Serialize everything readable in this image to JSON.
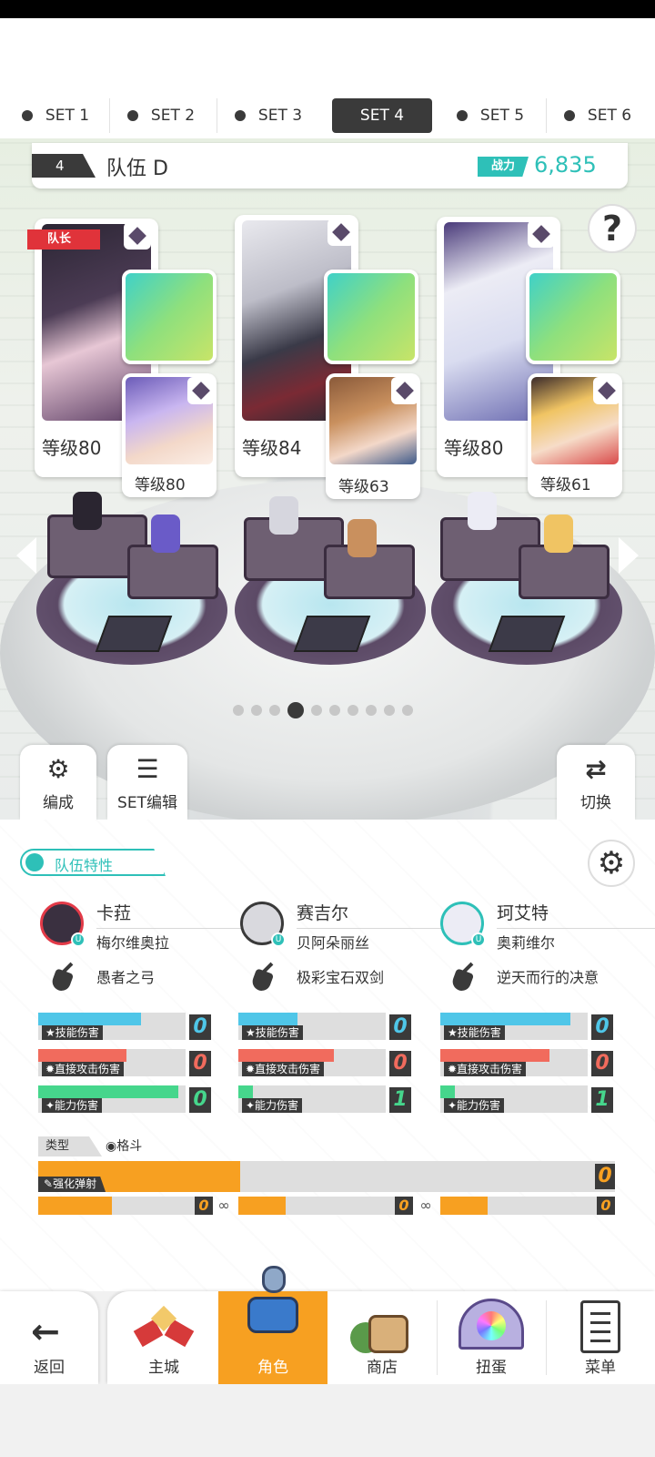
{
  "set_tabs": [
    "SET 1",
    "SET 2",
    "SET 3",
    "SET 4",
    "SET 5",
    "SET 6"
  ],
  "active_set_index": 3,
  "team": {
    "number": "4",
    "name": "队伍 D",
    "power_label": "战力",
    "power_value": "6,835"
  },
  "help_label": "?",
  "leader_tag": "队长",
  "characters": [
    {
      "level": "等级80",
      "sub_level": "等级80"
    },
    {
      "level": "等级84",
      "sub_level": "等级63"
    },
    {
      "level": "等级80",
      "sub_level": "等级61"
    }
  ],
  "page_dots": {
    "count": 10,
    "active_index": 3
  },
  "toolbar": {
    "formation_label": "编成",
    "set_edit_label": "SET编辑",
    "switch_label": "切换"
  },
  "team_traits": {
    "tab_label": "队伍特性"
  },
  "heroes": [
    {
      "name": "卡菈",
      "partner": "梅尔维奥拉",
      "weapon": "愚者之弓",
      "badge": "U",
      "stats": [
        {
          "label": "★技能伤害",
          "value": "0",
          "fill": 0.7
        },
        {
          "label": "✹直接攻击伤害",
          "value": "0",
          "fill": 0.6
        },
        {
          "label": "✦能力伤害",
          "value": "0",
          "fill": 0.95
        }
      ]
    },
    {
      "name": "赛吉尔",
      "partner": "贝阿朵丽丝",
      "weapon": "极彩宝石双剑",
      "badge": "U",
      "stats": [
        {
          "label": "★技能伤害",
          "value": "0",
          "fill": 0.4
        },
        {
          "label": "✹直接攻击伤害",
          "value": "0",
          "fill": 0.65
        },
        {
          "label": "✦能力伤害",
          "value": "1",
          "fill": 0.1
        }
      ]
    },
    {
      "name": "珂艾特",
      "partner": "奥莉维尔",
      "weapon": "逆天而行的决意",
      "badge": "U",
      "stats": [
        {
          "label": "★技能伤害",
          "value": "0",
          "fill": 0.88
        },
        {
          "label": "✹直接攻击伤害",
          "value": "0",
          "fill": 0.74
        },
        {
          "label": "✦能力伤害",
          "value": "1",
          "fill": 0.1
        }
      ]
    }
  ],
  "type_section": {
    "label": "类型",
    "value": "格斗"
  },
  "strengthen": {
    "label": "强化弹射",
    "value": "0",
    "fill": 0.35,
    "parts": [
      {
        "value": "0",
        "fill": 0.47
      },
      {
        "value": "0",
        "fill": 0.3
      },
      {
        "value": "0",
        "fill": 0.3
      }
    ]
  },
  "nav": {
    "back": "返回",
    "items": [
      "主城",
      "角色",
      "商店",
      "扭蛋",
      "菜单"
    ],
    "active_index": 1
  },
  "colors": {
    "accent": "#2ec0b8",
    "orange": "#f7a021",
    "skill": "#4fc6e8",
    "direct": "#f16b5d",
    "ability": "#46d68c",
    "leader": "#e0333a"
  }
}
